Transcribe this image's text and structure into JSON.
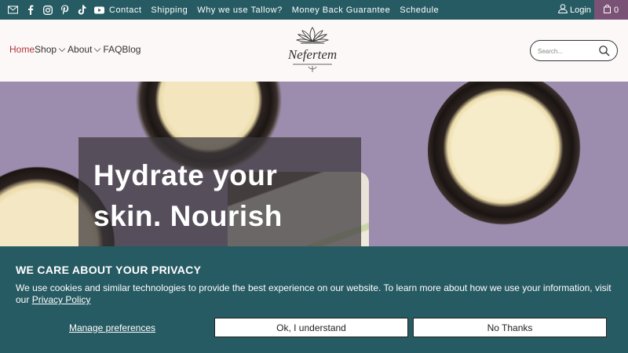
{
  "topbar": {
    "social_icons": [
      "mail-icon",
      "facebook-icon",
      "instagram-icon",
      "pinterest-icon",
      "tiktok-icon",
      "youtube-icon"
    ],
    "links": [
      "Contact",
      "Shipping",
      "Why we use Tallow?",
      "Money Back Guarantee",
      "Schedule"
    ],
    "login_label": "Login",
    "cart_count": "0"
  },
  "header": {
    "nav": [
      {
        "label": "Home",
        "active": true,
        "dropdown": false
      },
      {
        "label": "Shop",
        "active": false,
        "dropdown": true
      },
      {
        "label": "About",
        "active": false,
        "dropdown": true
      },
      {
        "label": "FAQ",
        "active": false,
        "dropdown": false
      },
      {
        "label": "Blog",
        "active": false,
        "dropdown": false
      }
    ],
    "logo_text": "Nefertem",
    "search_placeholder": "Search..."
  },
  "hero": {
    "headline": "Hydrate your skin. Nourish"
  },
  "cookie_banner": {
    "title": "WE CARE ABOUT YOUR PRIVACY",
    "text": "We use cookies and similar technologies to provide the best experience on our website. To learn more about how we use your information, visit our ",
    "policy_link": "Privacy Policy",
    "manage_label": "Manage preferences",
    "accept_label": "Ok, I understand",
    "decline_label": "No Thanks"
  },
  "colors": {
    "topbar_bg": "#275b63",
    "cart_bg": "#7a5275",
    "nav_active": "#b2343c",
    "hero_bg": "#9c8cad",
    "cookie_bg": "#275b63"
  }
}
